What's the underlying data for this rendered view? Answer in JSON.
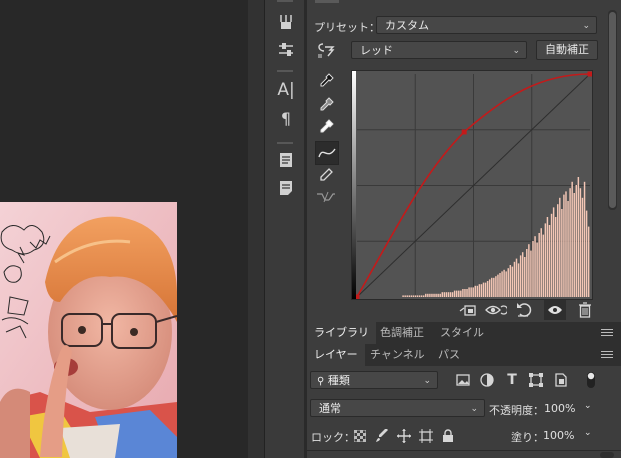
{
  "properties": {
    "preset_label": "プリセット：",
    "preset_value": "カスタム",
    "channel_value": "レッド",
    "auto_button": "自動補正"
  },
  "panel_tabs_top": [
    "ライブラリ",
    "色調補正",
    "スタイル"
  ],
  "panel_tabs_layers": [
    "レイヤー",
    "チャンネル",
    "パス"
  ],
  "layers": {
    "filter_kind": "種類",
    "blend_mode": "通常",
    "opacity_label": "不透明度：",
    "opacity_value": "100%",
    "lock_label": "ロック：",
    "fill_label": "塗り：",
    "fill_value": "100%"
  },
  "colors": {
    "curve": "#c41a1a",
    "histogram": "#f4c7b6",
    "panel": "#3d3d3d",
    "canvas": "#282828"
  },
  "curve_points": [
    [
      0,
      0
    ],
    [
      0.46,
      0.74
    ],
    [
      1,
      1
    ]
  ],
  "histogram": [
    0,
    0,
    0,
    0,
    0,
    0,
    0,
    0,
    0,
    0,
    0,
    0,
    0,
    0,
    0,
    0,
    0,
    0,
    0,
    0,
    0,
    0,
    1,
    1,
    1,
    1,
    1,
    1,
    1,
    1,
    1,
    1,
    1,
    2,
    2,
    2,
    2,
    2,
    2,
    2,
    2,
    3,
    3,
    3,
    3,
    3,
    3,
    4,
    4,
    4,
    4,
    5,
    5,
    5,
    6,
    6,
    6,
    7,
    7,
    8,
    8,
    9,
    9,
    10,
    11,
    12,
    12,
    13,
    14,
    15,
    16,
    17,
    16,
    18,
    20,
    19,
    22,
    24,
    21,
    26,
    28,
    25,
    30,
    33,
    29,
    35,
    38,
    34,
    40,
    43,
    39,
    46,
    50,
    45,
    52,
    56,
    50,
    58,
    62,
    55,
    64,
    66,
    60,
    68,
    72,
    65,
    70,
    75,
    68,
    62,
    72,
    54,
    44
  ],
  "icons": {
    "toolstrip": [
      "brush-options-icon",
      "sliders-icon",
      "character-icon",
      "paragraph-icon",
      "notes-icon",
      "info-icon"
    ],
    "curve_tools": [
      "target-adjust-icon",
      "black-point-eyedropper-icon",
      "gray-point-eyedropper-icon",
      "white-point-eyedropper-icon",
      "curve-edit-icon",
      "pencil-icon",
      "smooth-icon"
    ],
    "bottom_bar": [
      "clip-to-layer-icon",
      "view-previous-state-icon",
      "reset-icon",
      "visibility-icon",
      "trash-icon"
    ],
    "layer_filters": [
      "image-filter-icon",
      "adjustment-filter-icon",
      "type-filter-icon",
      "shape-filter-icon",
      "smart-object-filter-icon",
      "filter-toggle-icon"
    ],
    "locks": [
      "lock-pixels-icon",
      "lock-brush-icon",
      "lock-position-icon",
      "lock-artboard-icon",
      "lock-all-icon"
    ]
  }
}
